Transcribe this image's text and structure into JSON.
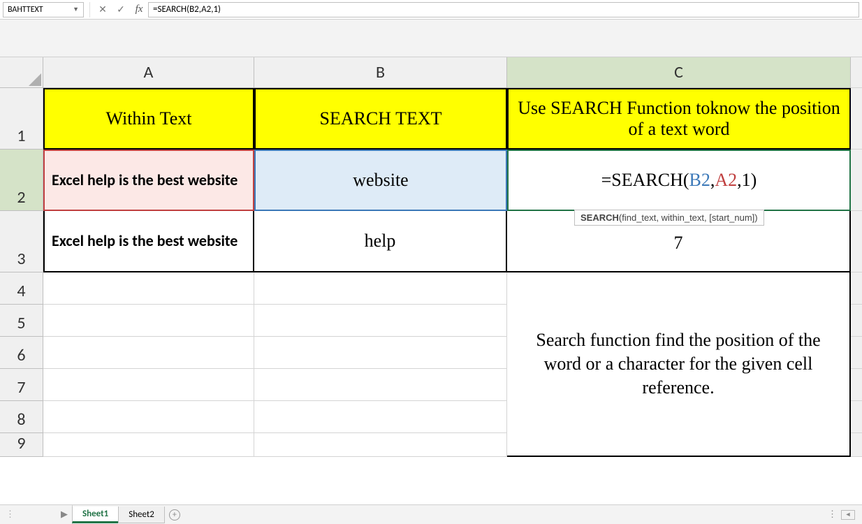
{
  "nameBox": "BAHTTEXT",
  "formula": "=SEARCH(B2,A2,1)",
  "columns": [
    "A",
    "B",
    "C"
  ],
  "rows": [
    "1",
    "2",
    "3",
    "4",
    "5",
    "6",
    "7",
    "8",
    "9"
  ],
  "headers": {
    "A": "Within Text",
    "B": "SEARCH TEXT",
    "C": "Use SEARCH Function toknow the position of a text word"
  },
  "data": {
    "A2": "Excel help is the best website",
    "B2": "website",
    "C2": {
      "prefix": "=SEARCH(",
      "b2": "B2",
      "c1": ",",
      "a2": "A2",
      "c2": ",",
      "one": "1",
      "suffix": ")"
    },
    "A3": "Excel help is the best website",
    "B3": "help",
    "C3": "7"
  },
  "tooltip": {
    "fn": "SEARCH",
    "args": "(find_text, within_text, [start_num])"
  },
  "note": "Search function find the position of the word or a character for the given cell reference.",
  "sheets": {
    "s1": "Sheet1",
    "s2": "Sheet2"
  }
}
